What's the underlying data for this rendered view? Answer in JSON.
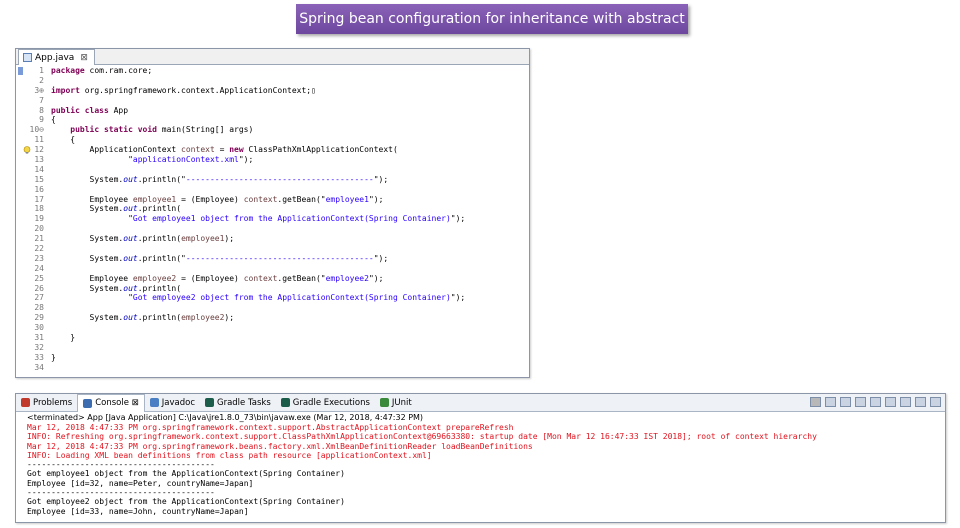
{
  "banner": {
    "title": "Spring bean configuration for inheritance with abstract"
  },
  "editor": {
    "tab_label": "App.java",
    "tab_close": "⊠",
    "lines": [
      {
        "n": "1",
        "t": [
          [
            "kw",
            "package"
          ],
          [
            "p",
            " com.ram.core;"
          ]
        ]
      },
      {
        "n": "2",
        "t": []
      },
      {
        "n": "3⊕",
        "t": [
          [
            "kw",
            "import"
          ],
          [
            "p",
            " org.springframework.context.ApplicationContext;▯"
          ]
        ]
      },
      {
        "n": "7",
        "t": []
      },
      {
        "n": "8",
        "t": [
          [
            "kw",
            "public class"
          ],
          [
            "p",
            " App"
          ]
        ]
      },
      {
        "n": "9",
        "t": [
          [
            "p",
            "{"
          ]
        ]
      },
      {
        "n": "10⊖",
        "t": [
          [
            "p",
            "    "
          ],
          [
            "kw",
            "public static void"
          ],
          [
            "p",
            " main(String[] args)"
          ]
        ]
      },
      {
        "n": "11",
        "t": [
          [
            "p",
            "    {"
          ]
        ]
      },
      {
        "n": "12",
        "t": [
          [
            "p",
            "        ApplicationContext "
          ],
          [
            "var",
            "context"
          ],
          [
            "p",
            " = "
          ],
          [
            "kw",
            "new"
          ],
          [
            "p",
            " ClassPathXmlApplicationContext("
          ]
        ],
        "marker": true
      },
      {
        "n": "13",
        "t": [
          [
            "p",
            "                \""
          ],
          [
            "str",
            "applicationContext.xml"
          ],
          [
            "p",
            "\");"
          ]
        ]
      },
      {
        "n": "14",
        "t": []
      },
      {
        "n": "15",
        "t": [
          [
            "p",
            "        System."
          ],
          [
            "fld",
            "out"
          ],
          [
            "p",
            ".println(\""
          ],
          [
            "str",
            "---------------------------------------"
          ],
          [
            "p",
            "\");"
          ]
        ]
      },
      {
        "n": "16",
        "t": []
      },
      {
        "n": "17",
        "t": [
          [
            "p",
            "        Employee "
          ],
          [
            "var",
            "employee1"
          ],
          [
            "p",
            " = (Employee) "
          ],
          [
            "var",
            "context"
          ],
          [
            "p",
            ".getBean(\""
          ],
          [
            "str",
            "employee1"
          ],
          [
            "p",
            "\");"
          ]
        ]
      },
      {
        "n": "18",
        "t": [
          [
            "p",
            "        System."
          ],
          [
            "fld",
            "out"
          ],
          [
            "p",
            ".println("
          ]
        ]
      },
      {
        "n": "19",
        "t": [
          [
            "p",
            "                \""
          ],
          [
            "str",
            "Got employee1 object from the ApplicationContext(Spring Container)"
          ],
          [
            "p",
            "\");"
          ]
        ]
      },
      {
        "n": "20",
        "t": []
      },
      {
        "n": "21",
        "t": [
          [
            "p",
            "        System."
          ],
          [
            "fld",
            "out"
          ],
          [
            "p",
            ".println("
          ],
          [
            "var",
            "employee1"
          ],
          [
            "p",
            ");"
          ]
        ]
      },
      {
        "n": "22",
        "t": []
      },
      {
        "n": "23",
        "t": [
          [
            "p",
            "        System."
          ],
          [
            "fld",
            "out"
          ],
          [
            "p",
            ".println(\""
          ],
          [
            "str",
            "---------------------------------------"
          ],
          [
            "p",
            "\");"
          ]
        ]
      },
      {
        "n": "24",
        "t": []
      },
      {
        "n": "25",
        "t": [
          [
            "p",
            "        Employee "
          ],
          [
            "var",
            "employee2"
          ],
          [
            "p",
            " = (Employee) "
          ],
          [
            "var",
            "context"
          ],
          [
            "p",
            ".getBean(\""
          ],
          [
            "str",
            "employee2"
          ],
          [
            "p",
            "\");"
          ]
        ]
      },
      {
        "n": "26",
        "t": [
          [
            "p",
            "        System."
          ],
          [
            "fld",
            "out"
          ],
          [
            "p",
            ".println("
          ]
        ]
      },
      {
        "n": "27",
        "t": [
          [
            "p",
            "                \""
          ],
          [
            "str",
            "Got employee2 object from the ApplicationContext(Spring Container)"
          ],
          [
            "p",
            "\");"
          ]
        ]
      },
      {
        "n": "28",
        "t": []
      },
      {
        "n": "29",
        "t": [
          [
            "p",
            "        System."
          ],
          [
            "fld",
            "out"
          ],
          [
            "p",
            ".println("
          ],
          [
            "var",
            "employee2"
          ],
          [
            "p",
            ");"
          ]
        ]
      },
      {
        "n": "30",
        "t": []
      },
      {
        "n": "31",
        "t": [
          [
            "p",
            "    }"
          ]
        ]
      },
      {
        "n": "32",
        "t": []
      },
      {
        "n": "33",
        "t": [
          [
            "p",
            "}"
          ]
        ]
      },
      {
        "n": "34",
        "t": []
      }
    ]
  },
  "console": {
    "tabs": [
      {
        "label": "Problems",
        "icon": "problems-icon",
        "active": false
      },
      {
        "label": "Console ⊠",
        "icon": "console-icon",
        "active": true
      },
      {
        "label": "Javadoc",
        "icon": "javadoc-icon",
        "active": false
      },
      {
        "label": "Gradle Tasks",
        "icon": "gradle-tasks-icon",
        "active": false
      },
      {
        "label": "Gradle Executions",
        "icon": "gradle-executions-icon",
        "active": false
      },
      {
        "label": "JUnit",
        "icon": "junit-icon",
        "active": false
      }
    ],
    "terminated": "<terminated> App [Java Application] C:\\Java\\jre1.8.0_73\\bin\\javaw.exe (Mar 12, 2018, 4:47:32 PM)",
    "output": [
      {
        "c": "red",
        "t": "Mar 12, 2018 4:47:33 PM org.springframework.context.support.AbstractApplicationContext prepareRefresh"
      },
      {
        "c": "red",
        "t": "INFO: Refreshing org.springframework.context.support.ClassPathXmlApplicationContext@69663380: startup date [Mon Mar 12 16:47:33 IST 2018]; root of context hierarchy"
      },
      {
        "c": "red",
        "t": "Mar 12, 2018 4:47:33 PM org.springframework.beans.factory.xml.XmlBeanDefinitionReader loadBeanDefinitions"
      },
      {
        "c": "red",
        "t": "INFO: Loading XML bean definitions from class path resource [applicationContext.xml]"
      },
      {
        "c": "blk",
        "t": "---------------------------------------"
      },
      {
        "c": "blk",
        "t": "Got employee1 object from the ApplicationContext(Spring Container)"
      },
      {
        "c": "blk",
        "t": "Employee [id=32, name=Peter, countryName=Japan]"
      },
      {
        "c": "blk",
        "t": "---------------------------------------"
      },
      {
        "c": "blk",
        "t": "Got employee2 object from the ApplicationContext(Spring Container)"
      },
      {
        "c": "blk",
        "t": "Employee [id=33, name=John, countryName=Japan]"
      }
    ],
    "toolbar_icons": [
      "terminate-icon",
      "remove-launch-icon",
      "remove-all-icon",
      "scroll-lock-icon",
      "word-wrap-icon",
      "pin-icon",
      "display-console-icon",
      "new-console-icon",
      "open-console-icon"
    ]
  }
}
